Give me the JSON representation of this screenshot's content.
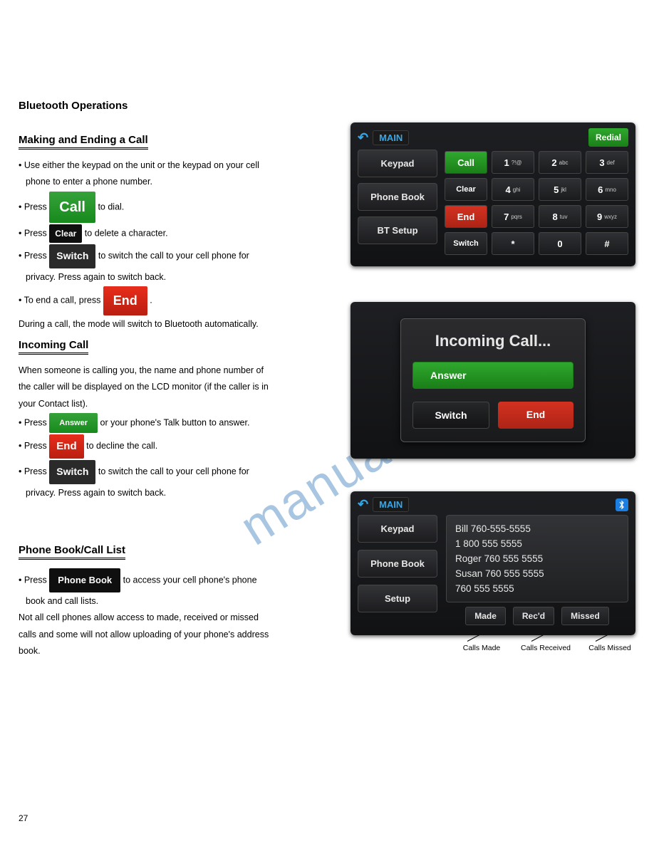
{
  "page": {
    "title": "Bluetooth Operations",
    "number": "27"
  },
  "watermark": "manualshive.com",
  "sections": {
    "making": {
      "header": "Making and Ending a Call",
      "line1_a": "• Use either the keypad on the unit or the keypad on your cell",
      "line1_b": "phone to enter a phone number.",
      "line2_a": "• Press ",
      "line2_b": " to dial.",
      "line3_a": "• Press ",
      "line3_b": " to delete a character.",
      "line4_a": "• Press ",
      "line4_b": " to switch the call to your cell phone for",
      "line4_c": "privacy. Press again to switch back.",
      "line5_a": "• To end a call, press ",
      "line5_b": ".",
      "line6": "During a call, the mode will switch to Bluetooth automatically.",
      "call_label": "Call",
      "clear_label": "Clear",
      "switch_label": "Switch",
      "end_label": "End"
    },
    "incoming": {
      "header": "Incoming Call",
      "p1": "When someone is calling you, the name and phone number of",
      "p1b": "the caller will be displayed on the LCD monitor (if the caller is in",
      "p1c": "your Contact list).",
      "line1_a": "• Press ",
      "line1_b": " or your phone's Talk button to answer.",
      "line2_a": "• Press ",
      "line2_b": " to decline the call.",
      "line3_a": "• Press ",
      "line3_b": " to switch the call to your cell phone for",
      "line3_c": "privacy. Press again to switch back.",
      "answer_label": "Answer",
      "end_label": "End",
      "switch_label": "Switch"
    },
    "phonebook": {
      "header": "Phone Book/Call List",
      "line1_a": "• Press ",
      "line1_b": " to access your cell phone's phone",
      "line2": "book and call lists.",
      "line3": "Not all cell phones allow access to made, received or missed",
      "line3b": "calls and some will not allow uploading of your phone's address",
      "line3c": "book.",
      "pb_label": "Phone Book"
    }
  },
  "device1": {
    "main": "MAIN",
    "redial": "Redial",
    "sidebar": [
      "Keypad",
      "Phone Book",
      "BT Setup"
    ],
    "grid": [
      [
        {
          "label": "Call",
          "cls": "green"
        },
        {
          "label": "1",
          "sub": "?!@"
        },
        {
          "label": "2",
          "sub": "abc"
        },
        {
          "label": "3",
          "sub": "def"
        }
      ],
      [
        {
          "label": "Clear",
          "cls": "small"
        },
        {
          "label": "4",
          "sub": "ghi"
        },
        {
          "label": "5",
          "sub": "jkl"
        },
        {
          "label": "6",
          "sub": "mno"
        }
      ],
      [
        {
          "label": "End",
          "cls": "red"
        },
        {
          "label": "7",
          "sub": "pqrs"
        },
        {
          "label": "8",
          "sub": "tuv"
        },
        {
          "label": "9",
          "sub": "wxyz"
        }
      ],
      [
        {
          "label": "Switch",
          "cls": "small"
        },
        {
          "label": "*"
        },
        {
          "label": "0"
        },
        {
          "label": "#"
        }
      ]
    ]
  },
  "device2": {
    "title": "Incoming Call...",
    "answer": "Answer",
    "switch": "Switch",
    "end": "End"
  },
  "device3": {
    "main": "MAIN",
    "sidebar": [
      "Keypad",
      "Phone Book",
      "Setup"
    ],
    "entries": [
      "Bill  760-555-5555",
      "1 800 555 5555",
      "Roger  760 555 5555",
      "Susan  760 555 5555",
      "760 555 5555"
    ],
    "tabs": [
      "Made",
      "Rec'd",
      "Missed"
    ]
  },
  "call_labels": [
    "Calls Made",
    "Calls Received",
    "Calls Missed"
  ]
}
